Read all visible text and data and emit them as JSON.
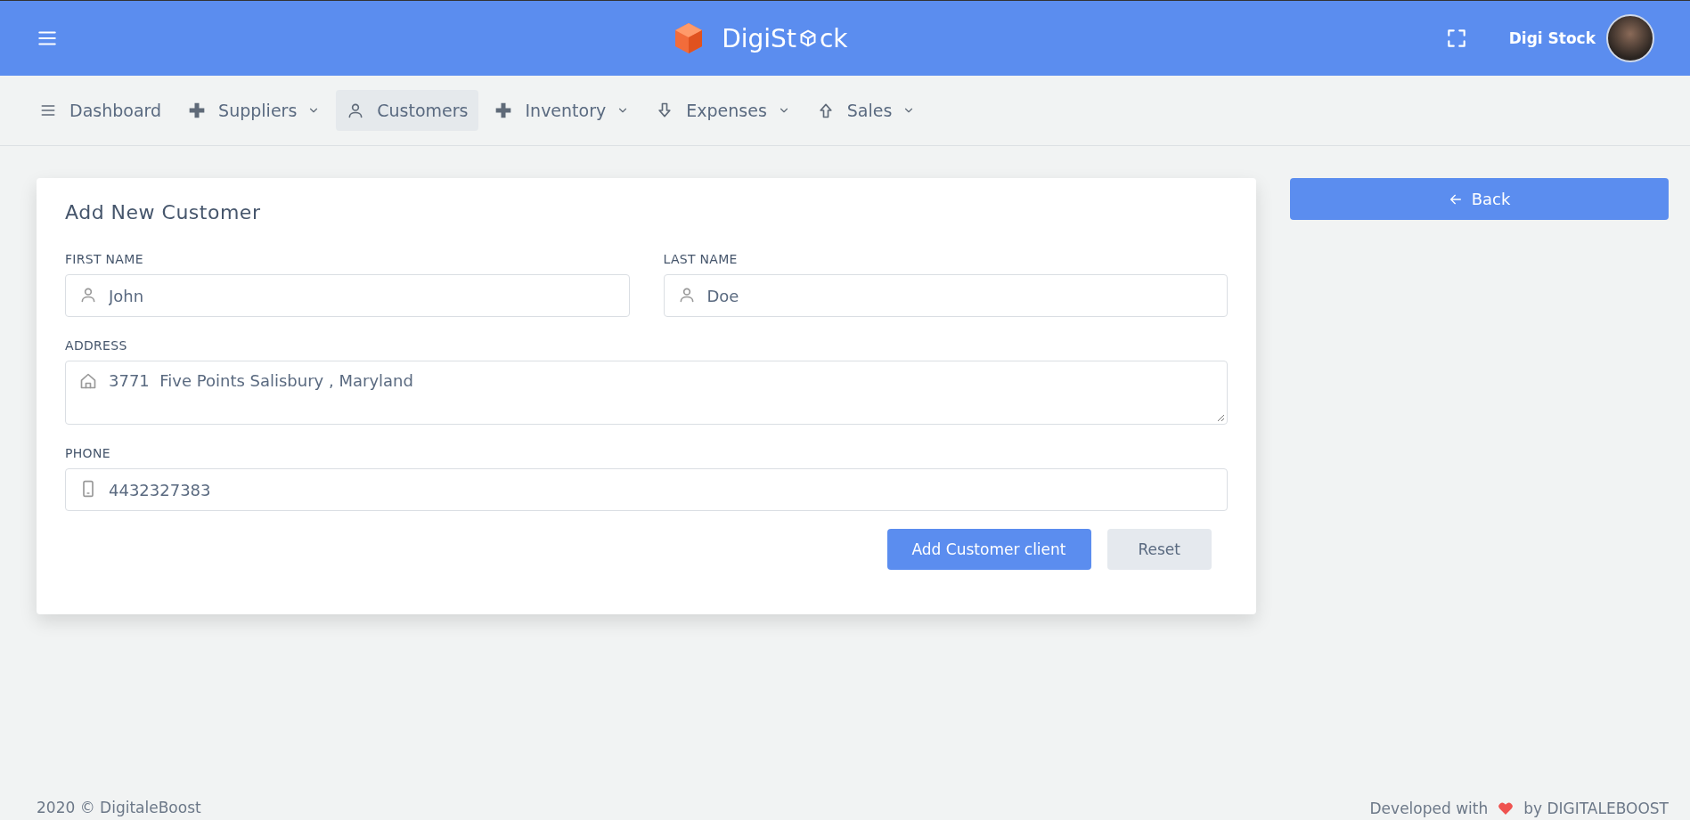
{
  "header": {
    "logo": {
      "before": "DigiSt",
      "after": "ck"
    },
    "user_name": "Digi Stock"
  },
  "nav": [
    {
      "label": "Dashboard",
      "kind": "menu",
      "dropdown": false,
      "selected": false
    },
    {
      "label": "Suppliers",
      "kind": "plus",
      "dropdown": true,
      "selected": false
    },
    {
      "label": "Customers",
      "kind": "user",
      "dropdown": false,
      "selected": true
    },
    {
      "label": "Inventory",
      "kind": "plus",
      "dropdown": true,
      "selected": false
    },
    {
      "label": "Expenses",
      "kind": "download",
      "dropdown": true,
      "selected": false
    },
    {
      "label": "Sales",
      "kind": "upload",
      "dropdown": true,
      "selected": false
    }
  ],
  "form": {
    "title": "Add New Customer",
    "fields": [
      {
        "label": "FIRST NAME",
        "value": "John",
        "kind": "name"
      },
      {
        "label": "LAST NAME",
        "value": "Doe",
        "kind": "name"
      },
      {
        "label": "ADDRESS",
        "value": "3771  Five Points Salisbury , Maryland",
        "kind": "address"
      },
      {
        "label": "PHONE",
        "value": "4432327383",
        "kind": "phone"
      }
    ],
    "buttons": [
      {
        "label": "Add Customer client",
        "kind": "primary"
      },
      {
        "label": "Reset",
        "kind": "secondary"
      }
    ]
  },
  "back_button": "Back",
  "footer": {
    "left": "2020 © DigitaleBoost",
    "right_before": "Developed with",
    "right_after": "by DIGITALEBOOST"
  }
}
